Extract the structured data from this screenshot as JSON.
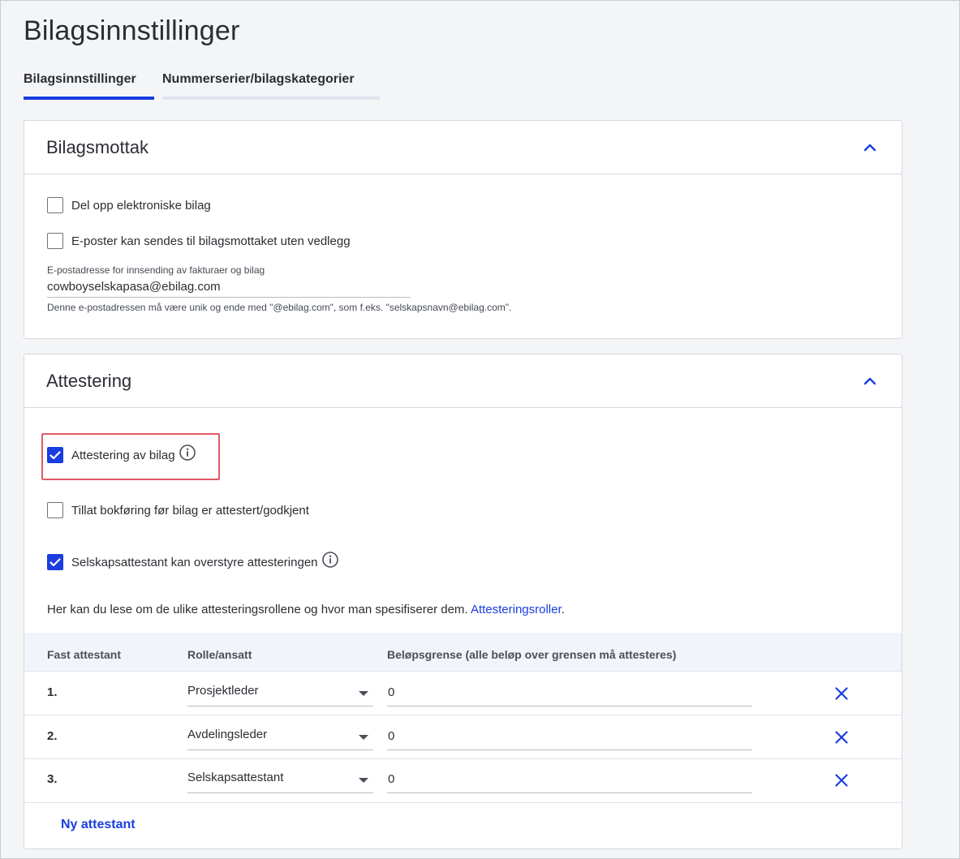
{
  "page": {
    "title": "Bilagsinnstillinger"
  },
  "tabs": [
    {
      "label": "Bilagsinnstillinger",
      "active": true
    },
    {
      "label": "Nummerserier/bilagskategorier",
      "active": false
    }
  ],
  "colors": {
    "accent": "#1a3de0",
    "highlight": "#e05a64"
  },
  "receipt": {
    "title": "Bilagsmottak",
    "options": [
      {
        "label": "Del opp elektroniske bilag",
        "checked": false
      },
      {
        "label": "E-poster kan sendes til bilagsmottaket uten vedlegg",
        "checked": false
      }
    ],
    "email": {
      "label": "E-postadresse for innsending av fakturaer og bilag",
      "value": "cowboyselskapasa@ebilag.com",
      "hint": "Denne e-postadressen må være unik og ende med \"@ebilag.com\", som f.eks. \"selskapsnavn@ebilag.com\"."
    }
  },
  "attest": {
    "title": "Attestering",
    "options": [
      {
        "label": "Attestering av bilag",
        "checked": true,
        "info": true
      },
      {
        "label": "Tillat bokføring før bilag er attestert/godkjent",
        "checked": false,
        "info": false
      },
      {
        "label": "Selskapsattestant kan overstyre attesteringen",
        "checked": true,
        "info": true
      }
    ],
    "help_text": "Her kan du lese om de ulike attesteringsrollene og hvor man spesifiserer dem. ",
    "help_link": "Attesteringsroller",
    "help_end": ".",
    "table": {
      "headers": [
        "Fast attestant",
        "Rolle/ansatt",
        "Beløpsgrense (alle beløp over grensen må attesteres)"
      ],
      "rows": [
        {
          "num": "1.",
          "role": "Prosjektleder",
          "amount": "0"
        },
        {
          "num": "2.",
          "role": "Avdelingsleder",
          "amount": "0"
        },
        {
          "num": "3.",
          "role": "Selskapsattestant",
          "amount": "0"
        }
      ]
    },
    "add_label": "Ny attestant"
  }
}
